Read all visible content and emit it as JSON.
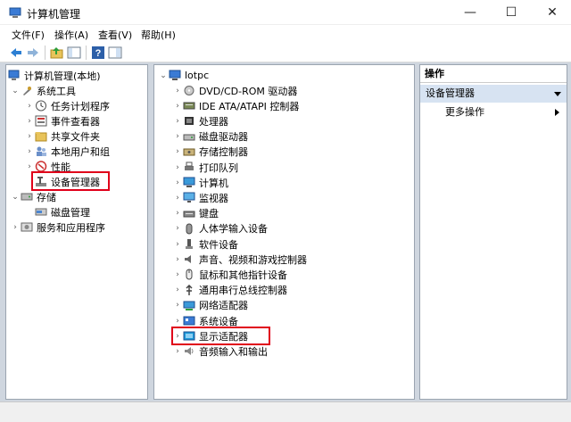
{
  "window": {
    "title": "计算机管理",
    "minimize_glyph": "—",
    "maximize_glyph": "☐",
    "close_glyph": "✕"
  },
  "menu": [
    "文件(F)",
    "操作(A)",
    "查看(V)",
    "帮助(H)"
  ],
  "left_tree": {
    "root": "计算机管理(本地)",
    "system_tools": "系统工具",
    "task_scheduler": "任务计划程序",
    "event_viewer": "事件查看器",
    "shared_folders": "共享文件夹",
    "local_users": "本地用户和组",
    "performance": "性能",
    "device_manager": "设备管理器",
    "storage": "存储",
    "disk_management": "磁盘管理",
    "services": "服务和应用程序"
  },
  "device_tree": {
    "computer_name": "lotpc",
    "categories": [
      "DVD/CD-ROM 驱动器",
      "IDE ATA/ATAPI 控制器",
      "处理器",
      "磁盘驱动器",
      "存储控制器",
      "打印队列",
      "计算机",
      "监视器",
      "键盘",
      "人体学输入设备",
      "软件设备",
      "声音、视频和游戏控制器",
      "鼠标和其他指针设备",
      "通用串行总线控制器",
      "网络适配器",
      "系统设备",
      "显示适配器",
      "音频输入和输出"
    ]
  },
  "actions": {
    "header": "操作",
    "section": "设备管理器",
    "more": "更多操作"
  },
  "highlight_color": "#e0001a",
  "selection_color": "#d7e3f2"
}
